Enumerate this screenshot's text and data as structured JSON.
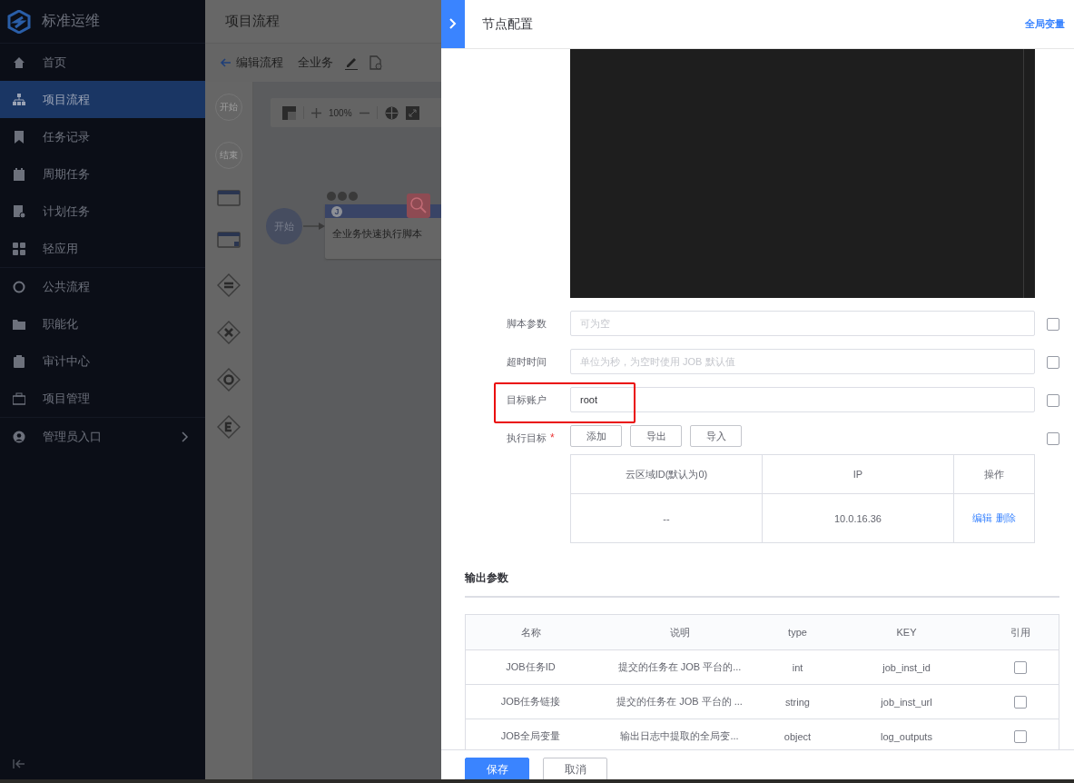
{
  "sidebar": {
    "title": "标准运维",
    "items": [
      {
        "label": "首页",
        "selected": false
      },
      {
        "label": "项目流程",
        "selected": true
      },
      {
        "label": "任务记录",
        "selected": false
      },
      {
        "label": "周期任务",
        "selected": false
      },
      {
        "label": "计划任务",
        "selected": false
      },
      {
        "label": "轻应用",
        "selected": false
      },
      {
        "label": "公共流程",
        "selected": false
      },
      {
        "label": "职能化",
        "selected": false
      },
      {
        "label": "审计中心",
        "selected": false
      },
      {
        "label": "项目管理",
        "selected": false
      },
      {
        "label": "管理员入口",
        "selected": false,
        "expandable": true
      }
    ]
  },
  "main": {
    "title": "项目流程",
    "back": "编辑流程",
    "name": "全业务",
    "palette": [
      "开始",
      "结束"
    ],
    "zoom": "100%",
    "start": "开始",
    "node": "全业务快速执行脚本",
    "node_badge": "J"
  },
  "panel": {
    "title": "节点配置",
    "link": "全局变量",
    "form": [
      {
        "kind": "input",
        "label": "脚本参数",
        "placeholder": "可为空",
        "highlighted": false,
        "checked": false
      },
      {
        "kind": "input",
        "label": "超时时间",
        "placeholder": "单位为秒，为空时使用 JOB 默认值",
        "highlighted": false,
        "checked": false
      },
      {
        "kind": "input",
        "label": "目标账户",
        "value": "root",
        "highlighted": true,
        "checked": false
      },
      {
        "kind": "targets",
        "label": "执行目标",
        "required_mark": "*",
        "buttons": [
          "添加",
          "导出",
          "导入"
        ],
        "highlighted": false,
        "checked": false,
        "columns": [
          "云区域ID(默认为0)",
          "IP",
          "操作"
        ],
        "rows": [
          {
            "cells": [
              "--",
              "10.0.16.36"
            ],
            "actions": [
              "编辑",
              "删除"
            ]
          }
        ]
      }
    ],
    "output": {
      "title": "输出参数",
      "columns": [
        "名称",
        "说明",
        "type",
        "KEY",
        "引用"
      ],
      "rows": [
        {
          "name": "JOB任务ID",
          "description": "提交的任务在 JOB 平台的...",
          "type": "int",
          "key": "job_inst_id",
          "referenced": false
        },
        {
          "name": "JOB任务链接",
          "description": "提交的任务在 JOB 平台的 ...",
          "type": "string",
          "key": "job_inst_url",
          "referenced": false
        },
        {
          "name": "JOB全局变量",
          "description": "输出日志中提取的全局变...",
          "type": "object",
          "key": "log_outputs",
          "referenced": false
        }
      ]
    },
    "footer": [
      {
        "label": "保存",
        "primary": true
      },
      {
        "label": "取消",
        "primary": false
      }
    ]
  }
}
